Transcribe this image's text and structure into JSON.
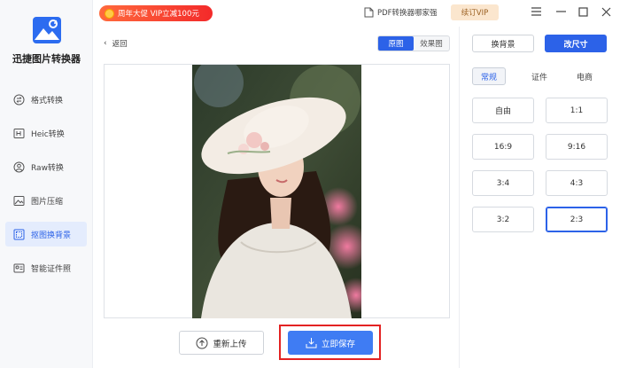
{
  "app": {
    "title": "迅捷图片转换器",
    "accent": "#2c62e8"
  },
  "sidebar": {
    "items": [
      {
        "label": "格式转换",
        "icon": "format-convert-icon"
      },
      {
        "label": "Heic转换",
        "icon": "heic-icon"
      },
      {
        "label": "Raw转换",
        "icon": "raw-icon"
      },
      {
        "label": "图片压缩",
        "icon": "compress-icon"
      },
      {
        "label": "抠图换背景",
        "icon": "cutout-icon",
        "active": true
      },
      {
        "label": "智能证件照",
        "icon": "id-photo-icon"
      }
    ]
  },
  "topbar": {
    "promo": "周年大促 VIP立减100元",
    "pdf_link": "PDF转换器哪家强",
    "vip": "续订VIP"
  },
  "main": {
    "back": "返回",
    "view_original": "原图",
    "view_effect": "效果图",
    "reupload": "重新上传",
    "save": "立即保存"
  },
  "right": {
    "change_bg": "换背景",
    "resize": "改尺寸",
    "subtabs": [
      "常规",
      "证件",
      "电商"
    ],
    "ratios": [
      "自由",
      "1:1",
      "16:9",
      "9:16",
      "3:4",
      "4:3",
      "3:2",
      "2:3"
    ],
    "selected_ratio": "2:3"
  }
}
